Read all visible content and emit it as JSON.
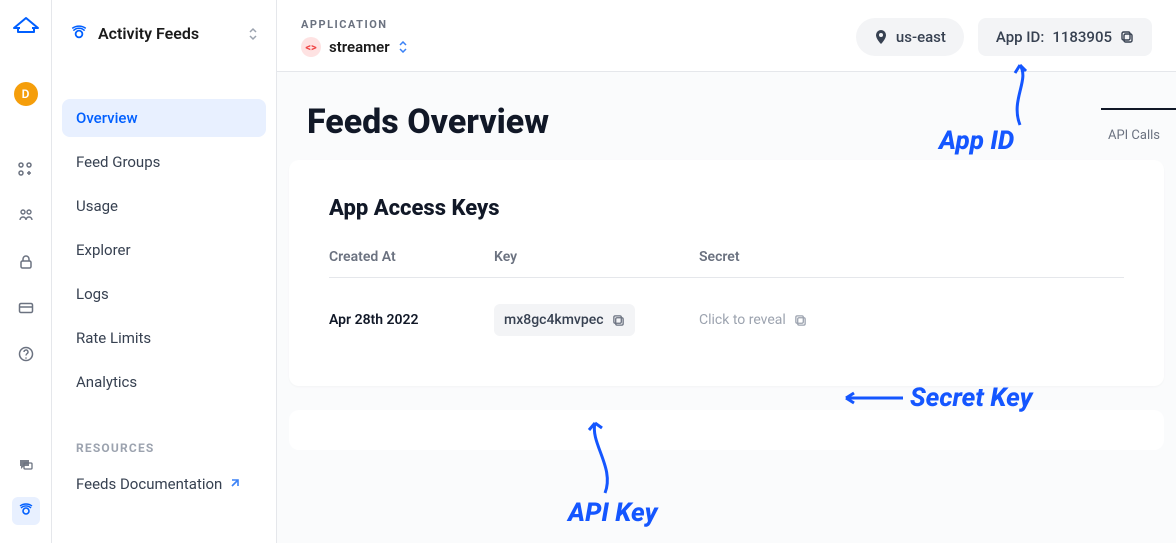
{
  "rail": {
    "avatar_initial": "D"
  },
  "sidebar": {
    "section_title": "Activity Feeds",
    "items": [
      {
        "label": "Overview"
      },
      {
        "label": "Feed Groups"
      },
      {
        "label": "Usage"
      },
      {
        "label": "Explorer"
      },
      {
        "label": "Logs"
      },
      {
        "label": "Rate Limits"
      },
      {
        "label": "Analytics"
      }
    ],
    "resources_label": "RESOURCES",
    "doc_link": "Feeds Documentation"
  },
  "topbar": {
    "application_label": "APPLICATION",
    "app_name": "streamer",
    "region": "us-east",
    "app_id_label": "App ID:",
    "app_id_value": "1183905"
  },
  "page": {
    "title": "Feeds Overview",
    "api_calls_label": "API Calls"
  },
  "access_keys": {
    "heading": "App Access Keys",
    "headers": {
      "created": "Created At",
      "key": "Key",
      "secret": "Secret"
    },
    "row": {
      "created_at": "Apr 28th 2022",
      "key": "mx8gc4kmvpec",
      "secret_placeholder": "Click to reveal"
    }
  },
  "annotations": {
    "app_id": "App ID",
    "api_key": "API Key",
    "secret_key": "Secret Key"
  }
}
